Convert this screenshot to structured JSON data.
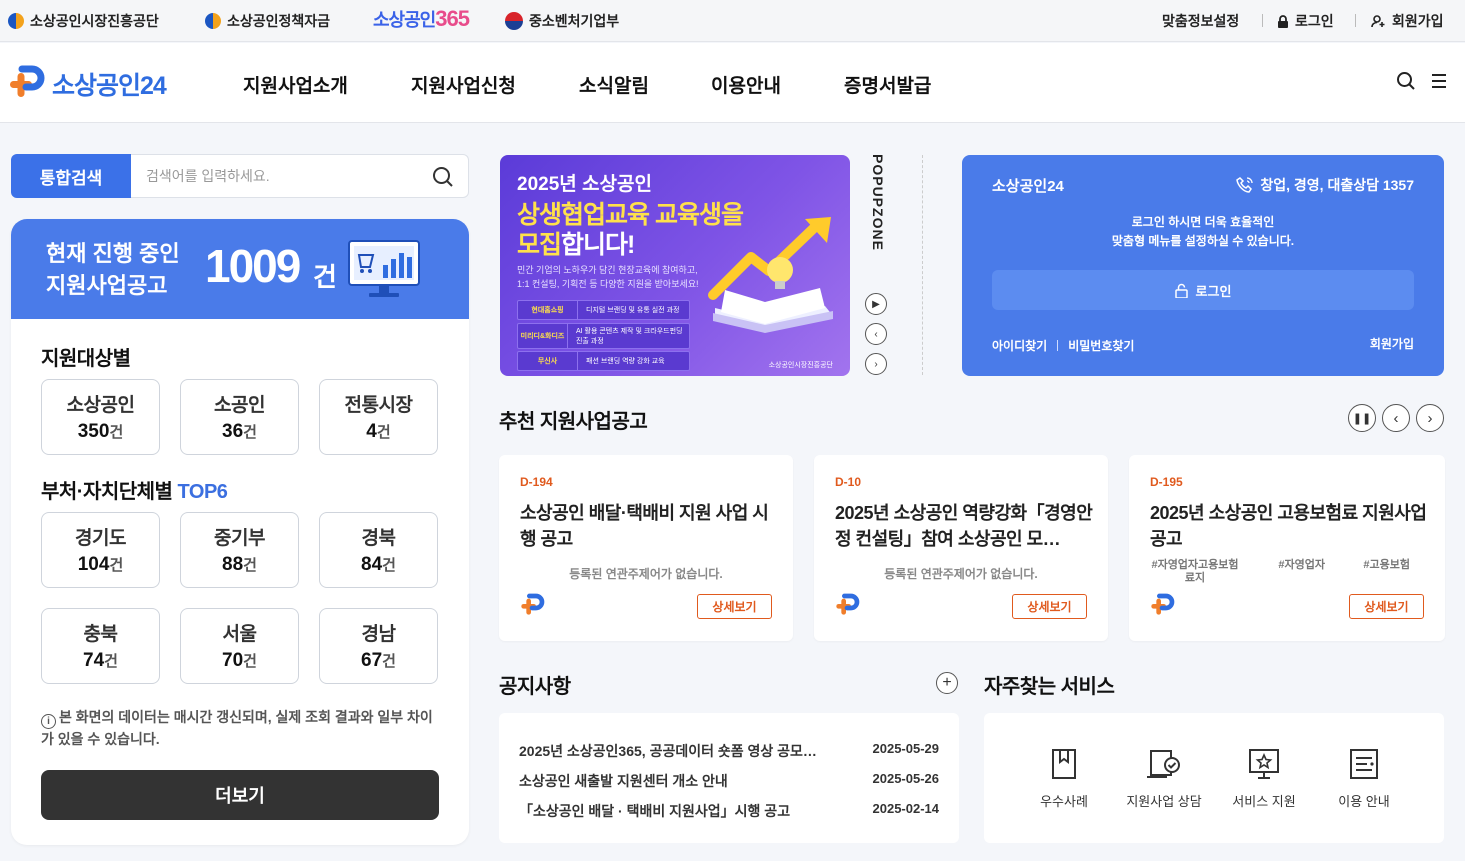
{
  "topbar": {
    "links": [
      "소상공인시장진흥공단",
      "소상공인정책자금",
      "중소벤처기업부"
    ],
    "logo365_a": "소상공인",
    "logo365_b": "365",
    "right": {
      "custom": "맞춤정보설정",
      "login": "로그인",
      "join": "회원가입"
    }
  },
  "header": {
    "brand": "소상공인24",
    "menu": [
      "지원사업소개",
      "지원사업신청",
      "소식알림",
      "이용안내",
      "증명서발급"
    ]
  },
  "search": {
    "tab": "통합검색",
    "placeholder": "검색어를 입력하세요."
  },
  "summary": {
    "line1": "현재 진행 중인",
    "line2": "지원사업공고",
    "count": "1009",
    "unit": "건"
  },
  "target": {
    "title": "지원대상별",
    "items": [
      {
        "name": "소상공인",
        "count": "350",
        "unit": "건"
      },
      {
        "name": "소공인",
        "count": "36",
        "unit": "건"
      },
      {
        "name": "전통시장",
        "count": "4",
        "unit": "건"
      }
    ]
  },
  "region": {
    "title": "부처·자치단체별",
    "title_accent": "TOP6",
    "items": [
      {
        "name": "경기도",
        "count": "104",
        "unit": "건"
      },
      {
        "name": "중기부",
        "count": "88",
        "unit": "건"
      },
      {
        "name": "경북",
        "count": "84",
        "unit": "건"
      },
      {
        "name": "충북",
        "count": "74",
        "unit": "건"
      },
      {
        "name": "서울",
        "count": "70",
        "unit": "건"
      },
      {
        "name": "경남",
        "count": "67",
        "unit": "건"
      }
    ]
  },
  "info": {
    "icon": "i",
    "text": "본 화면의 데이터는 매시간 갱신되며, 실제 조회 결과와 일부 차이가 있을 수 있습니다."
  },
  "more": "더보기",
  "banner": {
    "line1": "2025년 소상공인",
    "line2": "상생협업교육 교육생을",
    "line3a": "모집",
    "line3b": "합니다!",
    "desc": "민간 기업의 노하우가 담긴 현장교육에 참여하고, 1:1 컨설팅, 기획전 등 다양한 지원을 받아보세요!",
    "rows": [
      {
        "tag": "현대홈쇼핑",
        "text": "디지털 브랜딩 및 유통 실전 과정"
      },
      {
        "tag": "미리디&화디즈",
        "text": "AI 활용 콘텐츠 제작 및 크라우드펀딩 진출 과정"
      },
      {
        "tag": "무신사",
        "text": "패션 브랜딩 역량 강화 교육"
      }
    ],
    "footer": "소상공인시장진흥공단"
  },
  "popupzone": "POPUPZONE",
  "login": {
    "title": "소상공인24",
    "phone": "창업, 경영, 대출상담 1357",
    "msg1": "로그인 하시면 더욱 효율적인",
    "msg2": "맞춤형 메뉴를 설정하실 수 있습니다.",
    "button": "로그인",
    "find_id": "아이디찾기",
    "find_pw": "비밀번호찾기",
    "join": "회원가입"
  },
  "recommend": {
    "title": "추천 지원사업공고",
    "cards": [
      {
        "dday": "D-194",
        "title": "소상공인 배달·택배비 지원 사업 시행 공고",
        "keywords": "등록된 연관주제어가 없습니다.",
        "detail": "상세보기"
      },
      {
        "dday": "D-10",
        "title": "2025년 소상공인 역량강화「경영안정 컨설팅」참여 소상공인 모…",
        "keywords": "등록된 연관주제어가 없습니다.",
        "detail": "상세보기"
      },
      {
        "dday": "D-195",
        "title": "2025년 소상공인 고용보험료 지원사업 공고",
        "tags": [
          "#자영업자고용보험료지",
          "#자영업자",
          "#고용보험"
        ],
        "detail": "상세보기"
      }
    ]
  },
  "notices": {
    "title": "공지사항",
    "items": [
      {
        "title": "2025년 소상공인365, 공공데이터 숏폼 영상 공모…",
        "date": "2025-05-29"
      },
      {
        "title": "소상공인 새출발 지원센터 개소 안내",
        "date": "2025-05-26"
      },
      {
        "title": "「소상공인 배달 · 택배비 지원사업」시행 공고",
        "date": "2025-02-14"
      }
    ]
  },
  "services": {
    "title": "자주찾는 서비스",
    "items": [
      "우수사례",
      "지원사업 상담",
      "서비스 지원",
      "이용 안내"
    ]
  },
  "colors": {
    "primary": "#3b71e8",
    "accent": "#e05a1e",
    "dark": "#333333"
  }
}
